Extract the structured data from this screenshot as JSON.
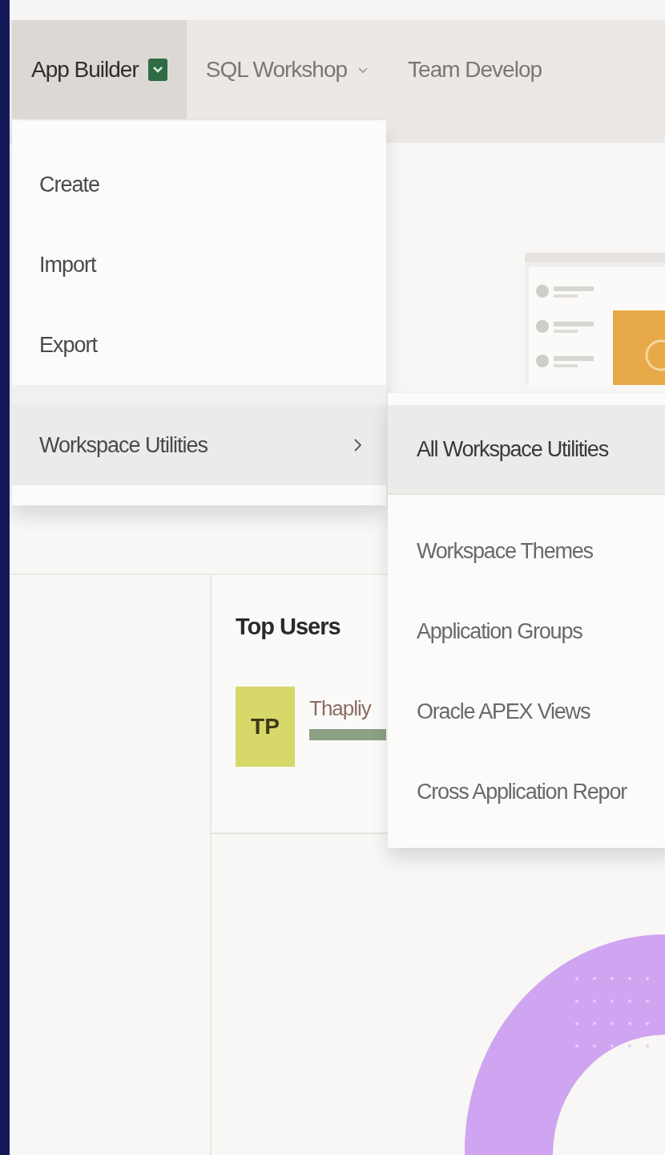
{
  "nav": {
    "tabs": [
      {
        "label": "App Builder",
        "selected": true,
        "menu_open": true
      },
      {
        "label": "SQL Workshop",
        "selected": false,
        "menu_open": false
      },
      {
        "label": "Team Develop",
        "selected": false
      }
    ]
  },
  "menu": {
    "items": [
      {
        "label": "Create",
        "selected": false,
        "submenu": false
      },
      {
        "label": "Import",
        "selected": false,
        "submenu": false
      },
      {
        "label": "Export",
        "selected": false,
        "submenu": false
      },
      {
        "label": "Workspace Utilities",
        "selected": true,
        "submenu": true
      }
    ]
  },
  "submenu": {
    "items": [
      {
        "label": "All Workspace Utilities",
        "selected": true
      },
      {
        "label": "Workspace Themes",
        "selected": false
      },
      {
        "label": "Application Groups",
        "selected": false
      },
      {
        "label": "Oracle APEX Views",
        "selected": false
      },
      {
        "label": "Cross Application Repor",
        "selected": false
      }
    ]
  },
  "top_users": {
    "title": "Top Users",
    "users": [
      {
        "initials": "TP",
        "name": "Thapliy"
      }
    ]
  }
}
